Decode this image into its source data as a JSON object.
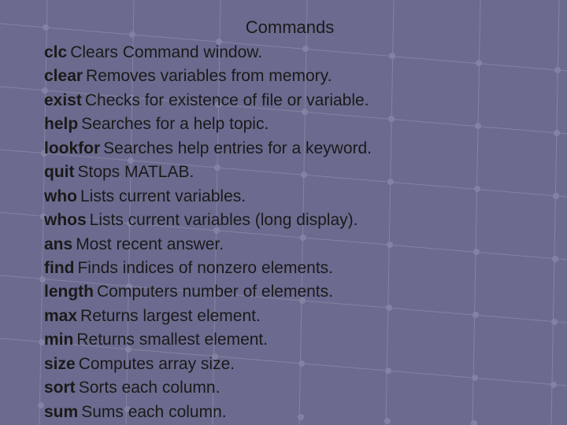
{
  "title": "Commands",
  "commands": [
    {
      "name": "clc",
      "desc": "Clears Command window."
    },
    {
      "name": "clear",
      "desc": "Removes variables from memory."
    },
    {
      "name": "exist",
      "desc": "Checks for existence of file or variable."
    },
    {
      "name": "help",
      "desc": "Searches for a help topic."
    },
    {
      "name": "lookfor",
      "desc": "Searches help entries for a keyword."
    },
    {
      "name": "quit",
      "desc": "Stops MATLAB."
    },
    {
      "name": "who",
      "desc": "Lists current variables."
    },
    {
      "name": "whos",
      "desc": "Lists current variables (long display)."
    },
    {
      "name": "ans",
      "desc": "Most recent answer."
    },
    {
      "name": "find",
      "desc": "Finds indices of nonzero elements."
    },
    {
      "name": "length",
      "desc": "Computers number of elements."
    },
    {
      "name": "max",
      "desc": "Returns largest element."
    },
    {
      "name": "min",
      "desc": "Returns smallest element."
    },
    {
      "name": "size",
      "desc": "Computes array size."
    },
    {
      "name": "sort",
      "desc": "Sorts each column."
    },
    {
      "name": "sum",
      "desc": "Sums each column."
    }
  ]
}
